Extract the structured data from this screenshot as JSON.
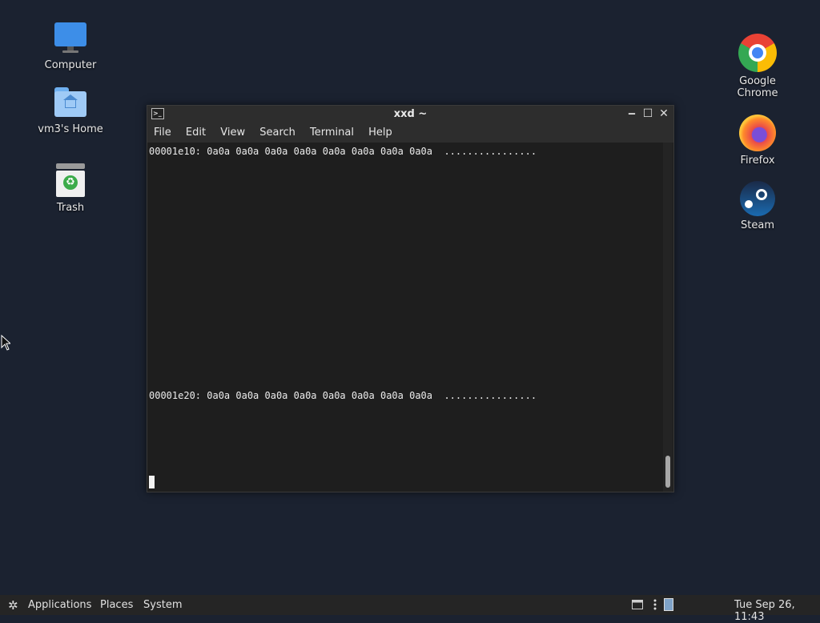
{
  "desktop": {
    "left_icons": [
      {
        "label": "Computer",
        "icon": "computer-icon"
      },
      {
        "label": "vm3's Home",
        "icon": "home-folder-icon"
      },
      {
        "label": "Trash",
        "icon": "trash-icon"
      }
    ],
    "right_icons": [
      {
        "label": "Google Chrome",
        "icon": "chrome-icon"
      },
      {
        "label": "Firefox",
        "icon": "firefox-icon"
      },
      {
        "label": "Steam",
        "icon": "steam-icon"
      }
    ]
  },
  "terminal": {
    "title": "xxd ~",
    "menu": [
      "File",
      "Edit",
      "View",
      "Search",
      "Terminal",
      "Help"
    ],
    "lines": [
      "00001e10: 0a0a 0a0a 0a0a 0a0a 0a0a 0a0a 0a0a 0a0a  ................",
      "00001e20: 0a0a 0a0a 0a0a 0a0a 0a0a 0a0a 0a0a 0a0a  ................"
    ]
  },
  "taskbar": {
    "applications": "Applications",
    "places": "Places",
    "system": "System",
    "clock": "Tue Sep 26, 11:43"
  },
  "colors": {
    "desktop_bg": "#1b2230",
    "terminal_bg": "#1e1e1e",
    "panel_bg": "#252525"
  }
}
